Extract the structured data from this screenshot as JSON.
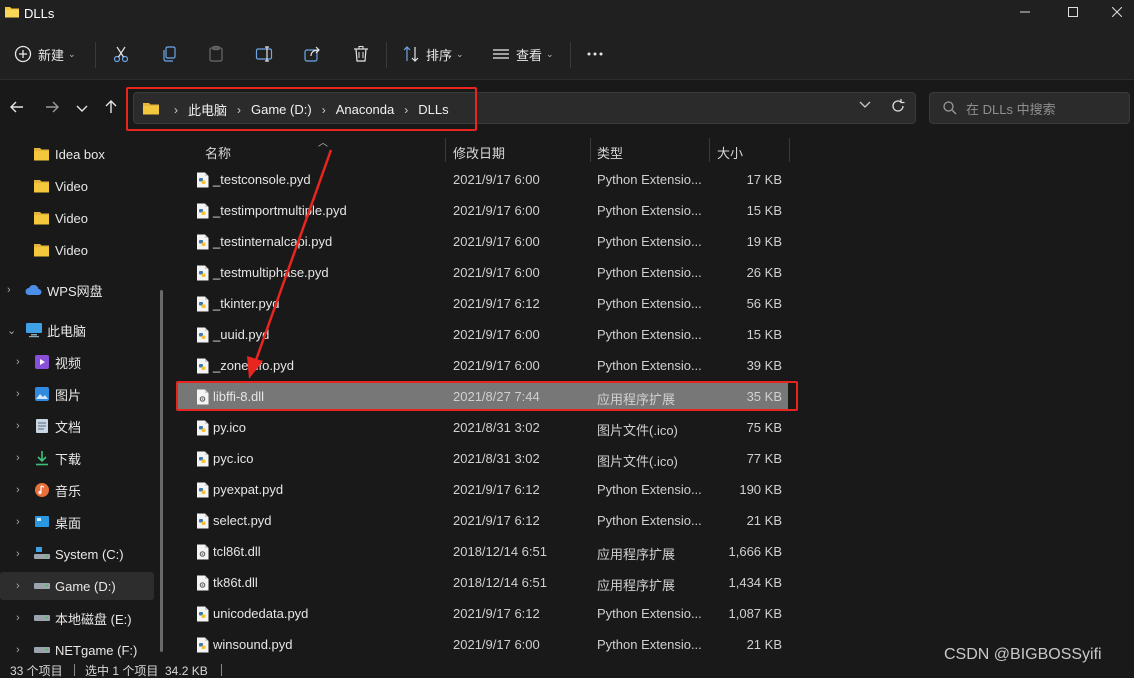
{
  "window": {
    "title": "DLLs"
  },
  "toolbar": {
    "new_label": "新建",
    "sort_label": "排序",
    "view_label": "查看"
  },
  "address": {
    "crumbs": [
      "此电脑",
      "Game (D:)",
      "Anaconda",
      "DLLs"
    ]
  },
  "search": {
    "placeholder": "在 DLLs 中搜索"
  },
  "sidebar": {
    "items": [
      {
        "label": "Idea box",
        "icon": "folder-icon"
      },
      {
        "label": "Video",
        "icon": "folder-icon"
      },
      {
        "label": "Video",
        "icon": "folder-icon"
      },
      {
        "label": "Video",
        "icon": "folder-icon"
      },
      {
        "label": "WPS网盘",
        "icon": "cloud-icon"
      },
      {
        "label": "此电脑",
        "icon": "computer-icon"
      },
      {
        "label": "视频",
        "icon": "video-icon"
      },
      {
        "label": "图片",
        "icon": "picture-icon"
      },
      {
        "label": "文档",
        "icon": "document-icon"
      },
      {
        "label": "下载",
        "icon": "download-icon"
      },
      {
        "label": "音乐",
        "icon": "music-icon"
      },
      {
        "label": "桌面",
        "icon": "desktop-icon"
      },
      {
        "label": "System (C:)",
        "icon": "drive-icon"
      },
      {
        "label": "Game (D:)",
        "icon": "drive-icon"
      },
      {
        "label": "本地磁盘 (E:)",
        "icon": "drive-icon"
      },
      {
        "label": "NETgame (F:)",
        "icon": "drive-icon"
      }
    ]
  },
  "columns": {
    "name": "名称",
    "date": "修改日期",
    "type": "类型",
    "size": "大小"
  },
  "files": [
    {
      "name": "_testconsole.pyd",
      "date": "2021/9/17 6:00",
      "type": "Python Extensio...",
      "size": "17 KB",
      "icon": "python-file-icon"
    },
    {
      "name": "_testimportmultiple.pyd",
      "date": "2021/9/17 6:00",
      "type": "Python Extensio...",
      "size": "15 KB",
      "icon": "python-file-icon"
    },
    {
      "name": "_testinternalcapi.pyd",
      "date": "2021/9/17 6:00",
      "type": "Python Extensio...",
      "size": "19 KB",
      "icon": "python-file-icon"
    },
    {
      "name": "_testmultiphase.pyd",
      "date": "2021/9/17 6:00",
      "type": "Python Extensio...",
      "size": "26 KB",
      "icon": "python-file-icon"
    },
    {
      "name": "_tkinter.pyd",
      "date": "2021/9/17 6:12",
      "type": "Python Extensio...",
      "size": "56 KB",
      "icon": "python-file-icon"
    },
    {
      "name": "_uuid.pyd",
      "date": "2021/9/17 6:00",
      "type": "Python Extensio...",
      "size": "15 KB",
      "icon": "python-file-icon"
    },
    {
      "name": "_zoneinfo.pyd",
      "date": "2021/9/17 6:00",
      "type": "Python Extensio...",
      "size": "39 KB",
      "icon": "python-file-icon"
    },
    {
      "name": "libffi-8.dll",
      "date": "2021/8/27 7:44",
      "type": "应用程序扩展",
      "size": "35 KB",
      "icon": "dll-file-icon"
    },
    {
      "name": "py.ico",
      "date": "2021/8/31 3:02",
      "type": "图片文件(.ico)",
      "size": "75 KB",
      "icon": "python-file-icon"
    },
    {
      "name": "pyc.ico",
      "date": "2021/8/31 3:02",
      "type": "图片文件(.ico)",
      "size": "77 KB",
      "icon": "python-file-icon"
    },
    {
      "name": "pyexpat.pyd",
      "date": "2021/9/17 6:12",
      "type": "Python Extensio...",
      "size": "190 KB",
      "icon": "python-file-icon"
    },
    {
      "name": "select.pyd",
      "date": "2021/9/17 6:12",
      "type": "Python Extensio...",
      "size": "21 KB",
      "icon": "python-file-icon"
    },
    {
      "name": "tcl86t.dll",
      "date": "2018/12/14 6:51",
      "type": "应用程序扩展",
      "size": "1,666 KB",
      "icon": "dll-file-icon"
    },
    {
      "name": "tk86t.dll",
      "date": "2018/12/14 6:51",
      "type": "应用程序扩展",
      "size": "1,434 KB",
      "icon": "dll-file-icon"
    },
    {
      "name": "unicodedata.pyd",
      "date": "2021/9/17 6:12",
      "type": "Python Extensio...",
      "size": "1,087 KB",
      "icon": "python-file-icon"
    },
    {
      "name": "winsound.pyd",
      "date": "2021/9/17 6:00",
      "type": "Python Extensio...",
      "size": "21 KB",
      "icon": "python-file-icon"
    }
  ],
  "selected_file": "libffi-8.dll",
  "status": {
    "count": "33 个项目",
    "selection": "选中 1 个项目  34.2 KB"
  },
  "watermark": "CSDN @BIGBOSSyifi",
  "colors": {
    "annotation_red": "#e8251f",
    "folder_yellow": "#f3c83d",
    "selected_row": "#777777"
  }
}
